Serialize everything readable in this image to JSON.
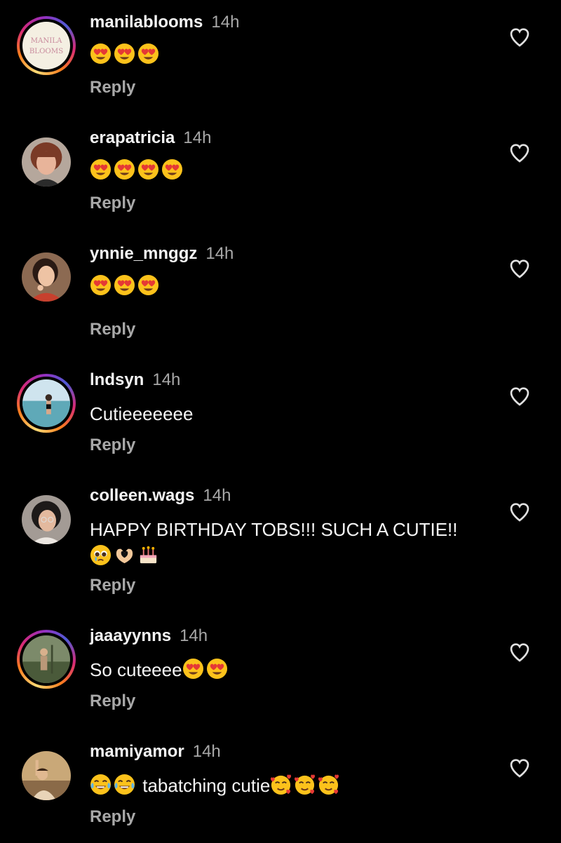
{
  "comments": [
    {
      "username": "manilablooms",
      "time": "14h",
      "text_before": "",
      "emojis": [
        "heart-eyes-emoji",
        "heart-eyes-emoji",
        "heart-eyes-emoji"
      ],
      "text_after": "",
      "reply_label": "Reply",
      "avatar_logo_line1": "MANILA",
      "avatar_logo_line2": "BLOOMS"
    },
    {
      "username": "erapatricia",
      "time": "14h",
      "text_before": "",
      "emojis": [
        "heart-eyes-emoji",
        "heart-eyes-emoji",
        "heart-eyes-emoji",
        "heart-eyes-emoji"
      ],
      "text_after": "",
      "reply_label": "Reply"
    },
    {
      "username": "ynnie_mnggz",
      "time": "14h",
      "text_before": "",
      "emojis": [
        "heart-eyes-emoji",
        "heart-eyes-emoji",
        "heart-eyes-emoji"
      ],
      "text_after": "",
      "reply_label": "Reply"
    },
    {
      "username": "lndsyn",
      "time": "14h",
      "text_before": "Cutieeeeeee",
      "emojis": [],
      "text_after": "",
      "reply_label": "Reply"
    },
    {
      "username": "colleen.wags",
      "time": "14h",
      "text_before": "HAPPY BIRTHDAY TOBS!!! SUCH A CUTIE!!",
      "emojis": [
        "pleading-face-emoji",
        "heart-hands-emoji",
        "birthday-cake-emoji"
      ],
      "text_after": "",
      "reply_label": "Reply"
    },
    {
      "username": "jaaayynns",
      "time": "14h",
      "text_before": "So cuteeee",
      "emojis": [
        "heart-eyes-emoji",
        "heart-eyes-emoji"
      ],
      "text_after": "",
      "reply_label": "Reply"
    },
    {
      "username": "mamiyamor",
      "time": "14h",
      "text_before": "",
      "emojis": [
        "tears-of-joy-emoji",
        "tears-of-joy-emoji"
      ],
      "text_after": " tabatching cutie",
      "emojis_after": [
        "smiling-hearts-emoji",
        "smiling-hearts-emoji",
        "smiling-hearts-emoji"
      ],
      "reply_label": "Reply"
    }
  ],
  "colors": {
    "background": "#000000",
    "username": "#f5f5f5",
    "secondary": "#a8a8a8",
    "story_ring": [
      "#feda75",
      "#fa7e1e",
      "#d62976",
      "#962fbf"
    ]
  }
}
